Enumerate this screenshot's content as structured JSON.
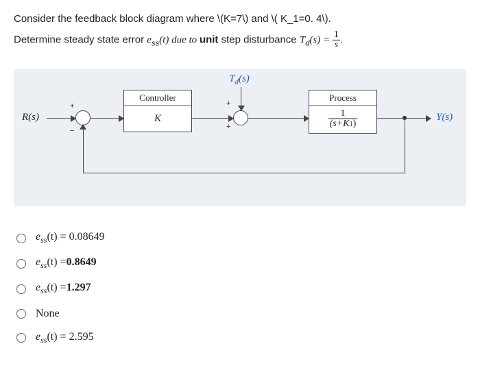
{
  "question": {
    "line1_a": "Consider the feedback block diagram where \\(K=7\\)  and \\( K_1=0. 4\\).",
    "line2_a": "Determine steady state error ",
    "line2_ess": "e",
    "line2_ess_sub": "ss",
    "line2_b": "(t) due to ",
    "line2_bold": "unit",
    "line2_c": " step disturbance ",
    "line2_td": "T",
    "line2_td_sub": "d",
    "line2_d": "(s) = ",
    "frac_num": "1",
    "frac_den": "s",
    "line2_e": "."
  },
  "diagram": {
    "controller_label": "Controller",
    "controller_value": "K",
    "process_label": "Process",
    "process_num": "1",
    "process_den_a": "(s+K",
    "process_den_sub": "1",
    "process_den_b": ")",
    "input": "R(s)",
    "output": "Y(s)",
    "disturbance": "T",
    "disturbance_sub": "d",
    "disturbance_b": "(s)",
    "plus": "+",
    "minus": "−"
  },
  "options": {
    "opt1_a": "e",
    "opt1_sub": "ss",
    "opt1_b": "(t) = 0.08649",
    "opt2_a": "e",
    "opt2_sub": "ss",
    "opt2_b": "(t) =",
    "opt2_c": "0.8649",
    "opt3_a": "e",
    "opt3_sub": "ss",
    "opt3_b": "(t) =",
    "opt3_c": "1.297",
    "opt4": "None",
    "opt5_a": "e",
    "opt5_sub": "ss",
    "opt5_b": "(t) = 2.595"
  }
}
